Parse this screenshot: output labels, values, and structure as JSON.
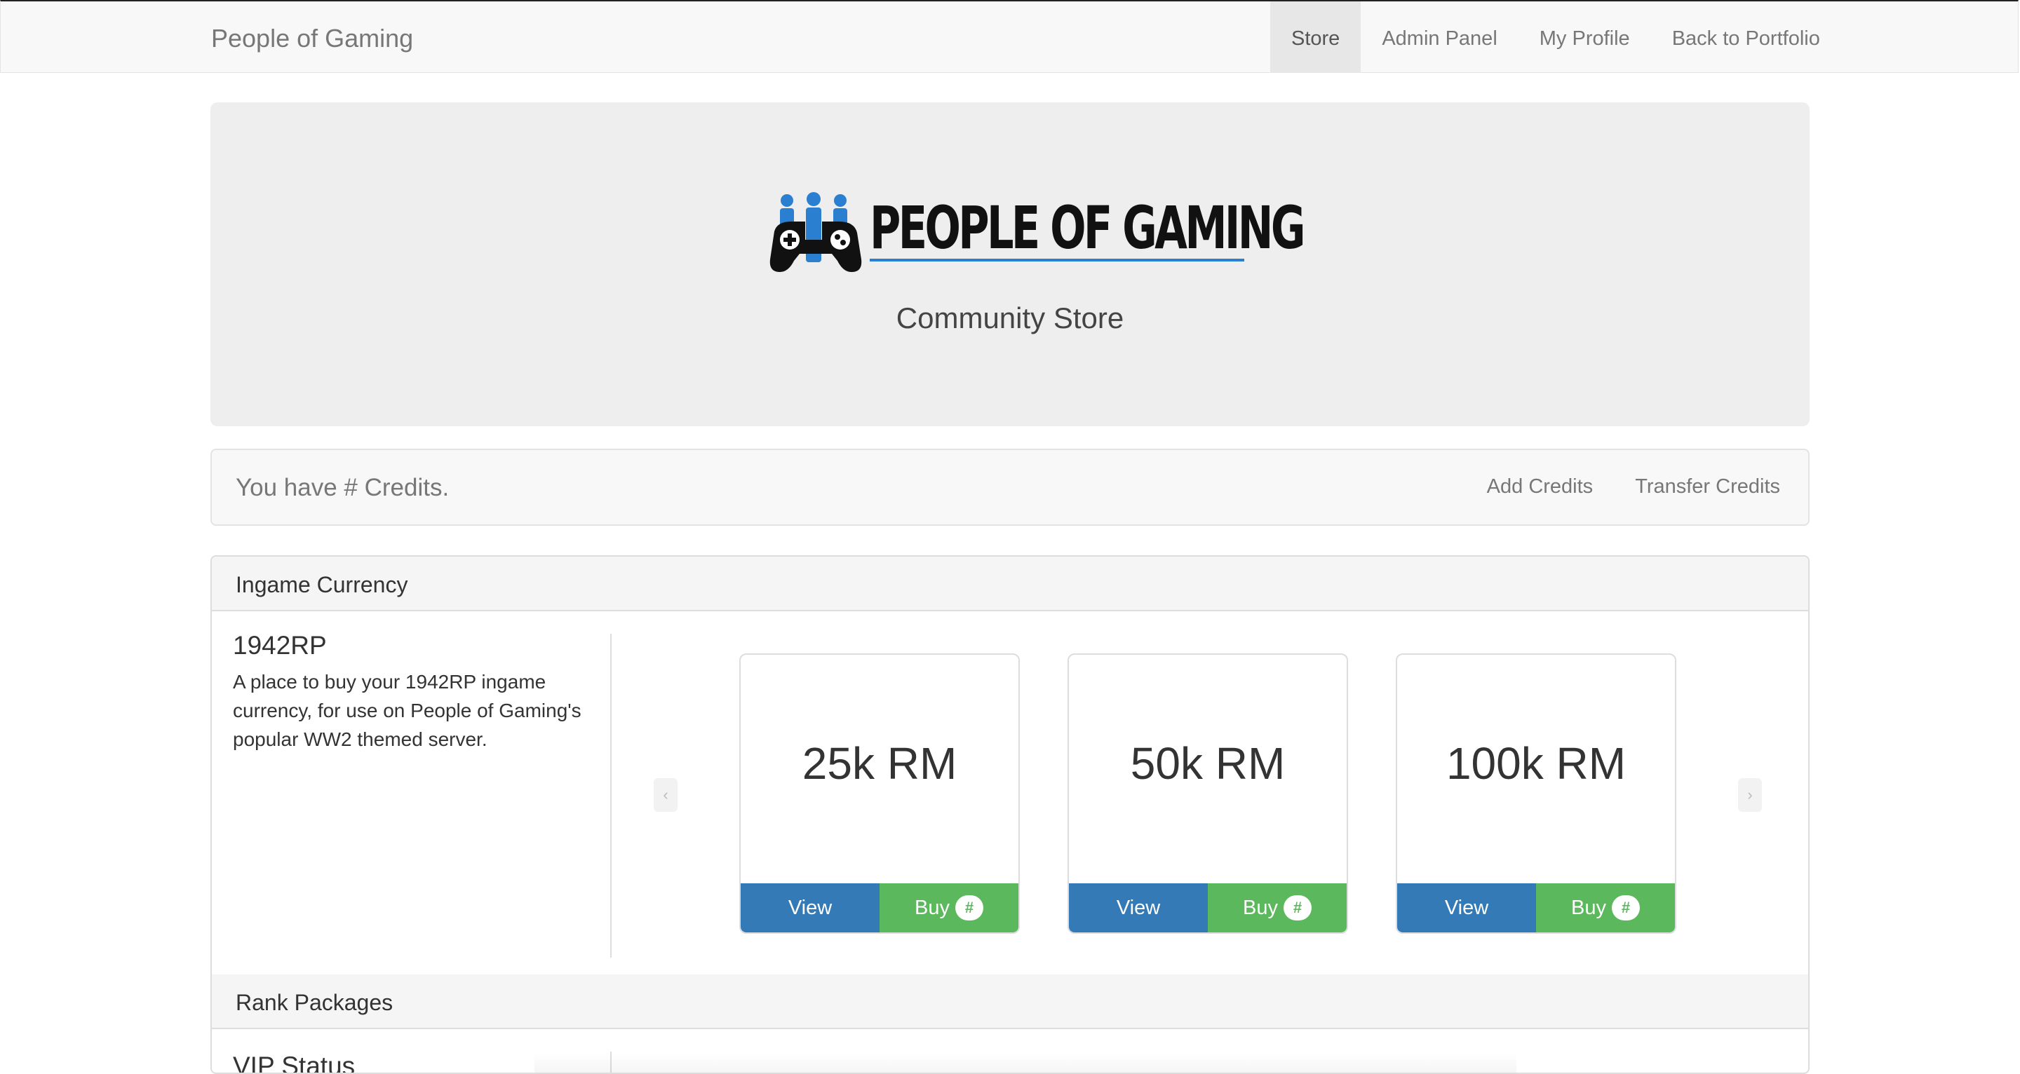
{
  "nav": {
    "brand": "People of Gaming",
    "items": [
      "Store",
      "Admin Panel",
      "My Profile",
      "Back to Portfolio"
    ],
    "active": "Store"
  },
  "hero": {
    "logo_text": "PEOPLE OF GAMING",
    "tagline": "Community Store"
  },
  "credits": {
    "text": "You have # Credits.",
    "actions": [
      "Add Credits",
      "Transfer Credits"
    ]
  },
  "sections": {
    "ingame": {
      "title": "Ingame Currency",
      "product": {
        "name": "1942RP",
        "description": "A place to buy your 1942RP ingame currency, for use on People of Gaming's popular WW2 themed server."
      },
      "cards": [
        {
          "title": "25k RM",
          "view": "View",
          "buy": "Buy",
          "badge": "#"
        },
        {
          "title": "50k RM",
          "view": "View",
          "buy": "Buy",
          "badge": "#"
        },
        {
          "title": "100k RM",
          "view": "View",
          "buy": "Buy",
          "badge": "#"
        }
      ]
    },
    "rank": {
      "title": "Rank Packages",
      "product_peek": "VIP Status"
    }
  },
  "colors": {
    "primary": "#337ab7",
    "success": "#5cb85c",
    "logo_blue": "#2a7fd0"
  }
}
